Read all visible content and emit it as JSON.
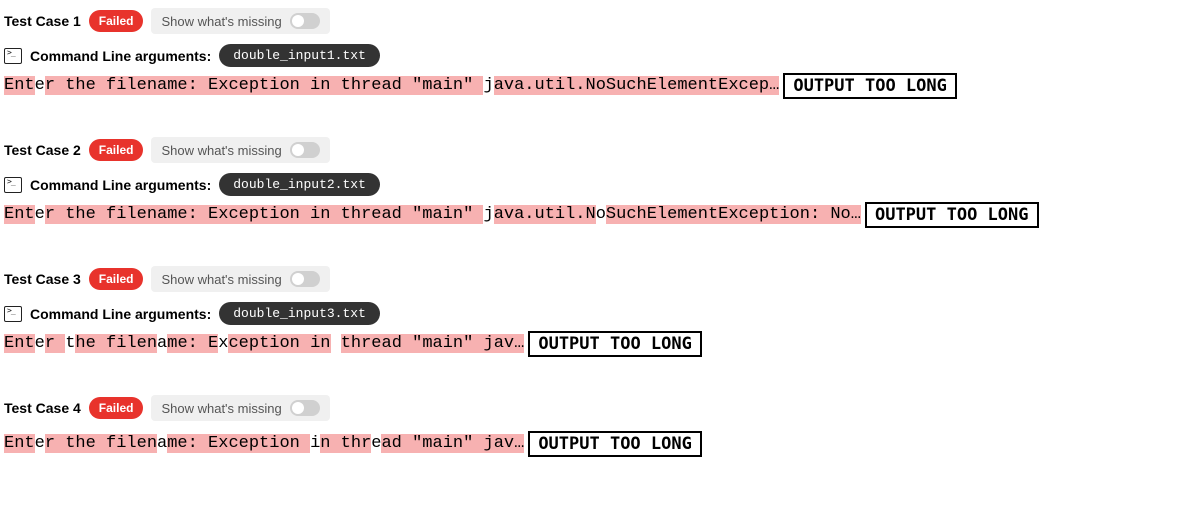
{
  "status_label": "Failed",
  "show_missing_label": "Show what's missing",
  "cmdline_label": "Command Line arguments:",
  "too_long_label": "OUTPUT TOO LONG",
  "test_cases": [
    {
      "title": "Test Case 1",
      "cmdline_arg": "double_input1.txt",
      "output_segments": [
        {
          "t": "Ent",
          "hl": true
        },
        {
          "t": "e",
          "hl": false
        },
        {
          "t": "r the filename: Exception in thread \"main\" ",
          "hl": true
        },
        {
          "t": "j",
          "hl": false
        },
        {
          "t": "ava.util.NoSuchElementExcep…",
          "hl": true
        }
      ]
    },
    {
      "title": "Test Case 2",
      "cmdline_arg": "double_input2.txt",
      "output_segments": [
        {
          "t": "Ent",
          "hl": true
        },
        {
          "t": "e",
          "hl": false
        },
        {
          "t": "r the filename: Exception in thread \"main\" ",
          "hl": true
        },
        {
          "t": "j",
          "hl": false
        },
        {
          "t": "ava.util.N",
          "hl": true
        },
        {
          "t": "o",
          "hl": false
        },
        {
          "t": "SuchElementException: No…",
          "hl": true
        }
      ]
    },
    {
      "title": "Test Case 3",
      "cmdline_arg": "double_input3.txt",
      "output_segments": [
        {
          "t": "Ent",
          "hl": true
        },
        {
          "t": "e",
          "hl": false
        },
        {
          "t": "r ",
          "hl": true
        },
        {
          "t": "t",
          "hl": false
        },
        {
          "t": "he filen",
          "hl": true
        },
        {
          "t": "a",
          "hl": false
        },
        {
          "t": "me: E",
          "hl": true
        },
        {
          "t": "x",
          "hl": false
        },
        {
          "t": "ception in",
          "hl": true
        },
        {
          "t": " ",
          "hl": false
        },
        {
          "t": "thread \"main\" jav…",
          "hl": true
        }
      ]
    },
    {
      "title": "Test Case 4",
      "cmdline_arg": null,
      "output_segments": [
        {
          "t": "Ent",
          "hl": true
        },
        {
          "t": "e",
          "hl": false
        },
        {
          "t": "r the filen",
          "hl": true
        },
        {
          "t": "a",
          "hl": false
        },
        {
          "t": "me: Exception ",
          "hl": true
        },
        {
          "t": "i",
          "hl": false
        },
        {
          "t": "n thr",
          "hl": true
        },
        {
          "t": "e",
          "hl": false
        },
        {
          "t": "ad \"main\" jav…",
          "hl": true
        }
      ]
    }
  ]
}
